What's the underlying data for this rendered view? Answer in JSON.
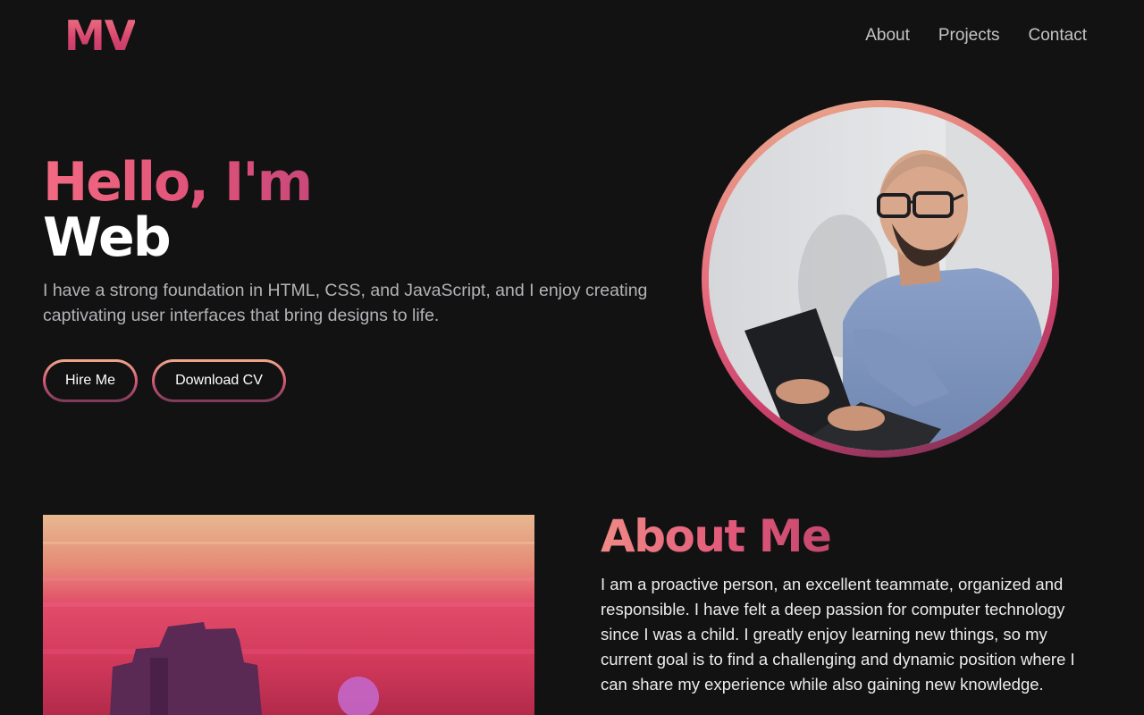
{
  "header": {
    "logo": "MV",
    "nav": [
      {
        "label": "About"
      },
      {
        "label": "Projects"
      },
      {
        "label": "Contact"
      }
    ]
  },
  "hero": {
    "greeting": "Hello, I'm",
    "role": "Web",
    "intro": "I have a strong foundation in HTML, CSS, and JavaScript, and I enjoy creating captivating user interfaces that bring designs to life.",
    "buttons": {
      "hire": "Hire Me",
      "cv": "Download CV"
    }
  },
  "about": {
    "title": "About Me",
    "text": "I am a proactive person, an excellent teammate, organized and responsible. I have felt a deep passion for computer technology since I was a child. I greatly enjoy learning new things, so my current goal is to find a challenging and dynamic position where I can share my experience while also gaining new knowledge."
  },
  "colors": {
    "background": "#121212",
    "accent_pink": "#e15379",
    "accent_peach": "#f0a98c",
    "muted_text": "#b3b3b8"
  }
}
